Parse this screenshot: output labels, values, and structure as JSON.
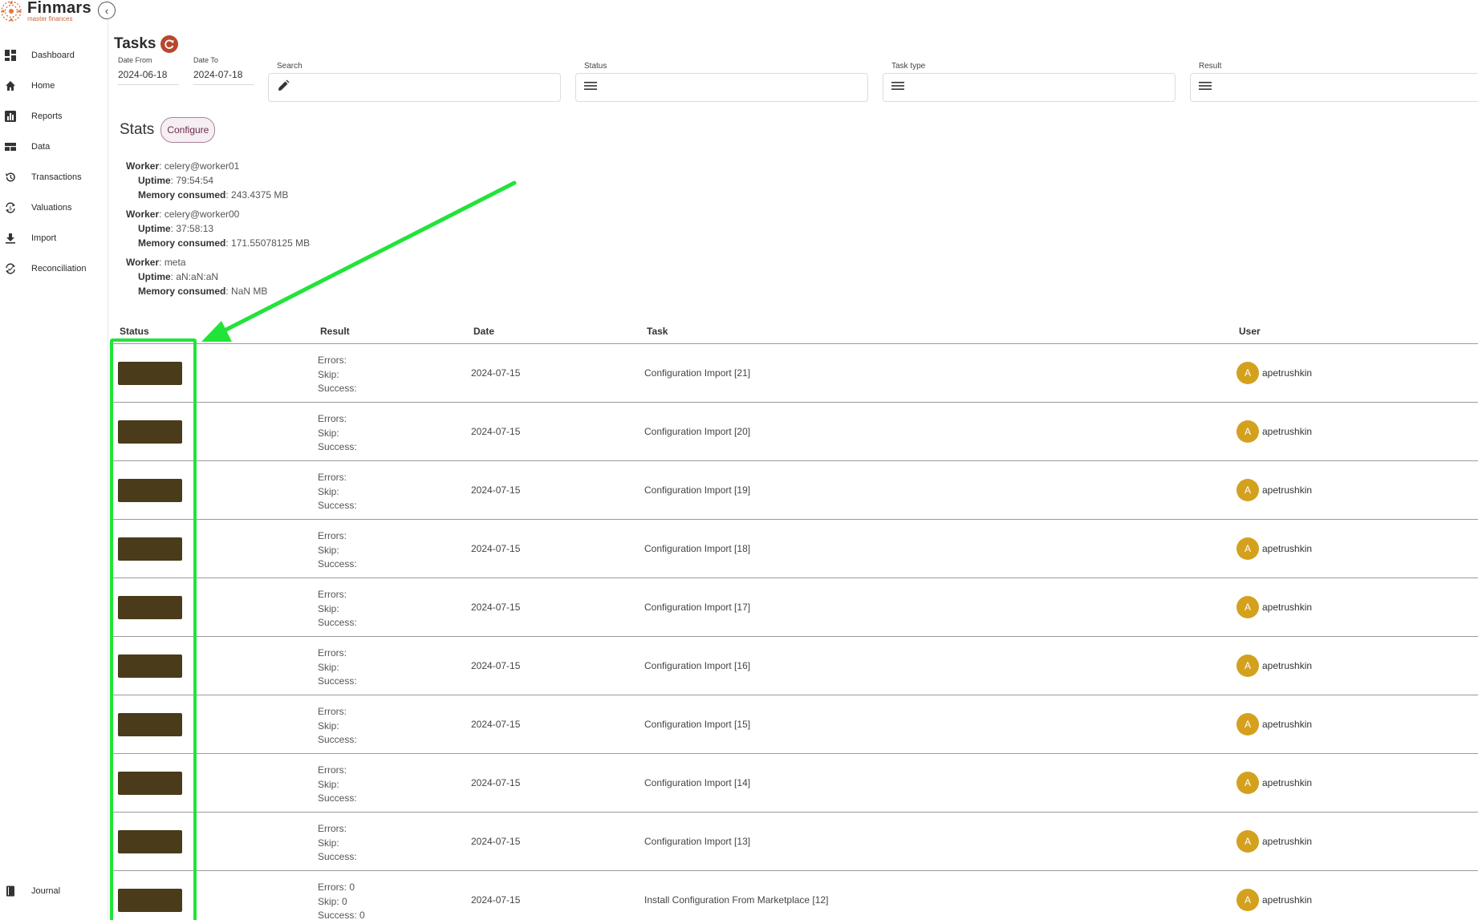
{
  "app": {
    "name": "Finmars",
    "tagline": "master finances"
  },
  "sidebar": {
    "items": [
      {
        "label": "Dashboard",
        "icon": "dashboard-icon"
      },
      {
        "label": "Home",
        "icon": "home-icon"
      },
      {
        "label": "Reports",
        "icon": "reports-icon"
      },
      {
        "label": "Data",
        "icon": "data-icon"
      },
      {
        "label": "Transactions",
        "icon": "history-icon"
      },
      {
        "label": "Valuations",
        "icon": "sync-icon"
      },
      {
        "label": "Import",
        "icon": "download-icon"
      },
      {
        "label": "Reconciliation",
        "icon": "reconcile-icon"
      }
    ],
    "bottom_items": [
      {
        "label": "Journal",
        "icon": "book-icon"
      }
    ]
  },
  "header": {
    "title": "Tasks"
  },
  "filters": {
    "date_from_label": "Date From",
    "date_from": "2024-06-18",
    "date_to_label": "Date To",
    "date_to": "2024-07-18",
    "search_label": "Search",
    "status_label": "Status",
    "task_type_label": "Task type",
    "result_label": "Result"
  },
  "stats": {
    "title": "Stats",
    "configure_label": "Configure",
    "worker_label": "Worker",
    "uptime_label": "Uptime",
    "memory_label": "Memory consumed",
    "workers": [
      {
        "name": "celery@worker01",
        "uptime": "79:54:54",
        "memory": "243.4375 MB"
      },
      {
        "name": "celery@worker00",
        "uptime": "37:58:13",
        "memory": "171.55078125 MB"
      },
      {
        "name": "meta",
        "uptime": "aN:aN:aN",
        "memory": "NaN MB"
      }
    ]
  },
  "table": {
    "columns": {
      "status": "Status",
      "result": "Result",
      "date": "Date",
      "task": "Task",
      "user": "User"
    },
    "rows": [
      {
        "errors": "Errors:",
        "skip": "Skip:",
        "success": "Success:",
        "date": "2024-07-15",
        "task": "Configuration Import [21]",
        "avatar": "A",
        "user": "apetrushkin"
      },
      {
        "errors": "Errors:",
        "skip": "Skip:",
        "success": "Success:",
        "date": "2024-07-15",
        "task": "Configuration Import [20]",
        "avatar": "A",
        "user": "apetrushkin"
      },
      {
        "errors": "Errors:",
        "skip": "Skip:",
        "success": "Success:",
        "date": "2024-07-15",
        "task": "Configuration Import [19]",
        "avatar": "A",
        "user": "apetrushkin"
      },
      {
        "errors": "Errors:",
        "skip": "Skip:",
        "success": "Success:",
        "date": "2024-07-15",
        "task": "Configuration Import [18]",
        "avatar": "A",
        "user": "apetrushkin"
      },
      {
        "errors": "Errors:",
        "skip": "Skip:",
        "success": "Success:",
        "date": "2024-07-15",
        "task": "Configuration Import [17]",
        "avatar": "A",
        "user": "apetrushkin"
      },
      {
        "errors": "Errors:",
        "skip": "Skip:",
        "success": "Success:",
        "date": "2024-07-15",
        "task": "Configuration Import [16]",
        "avatar": "A",
        "user": "apetrushkin"
      },
      {
        "errors": "Errors:",
        "skip": "Skip:",
        "success": "Success:",
        "date": "2024-07-15",
        "task": "Configuration Import [15]",
        "avatar": "A",
        "user": "apetrushkin"
      },
      {
        "errors": "Errors:",
        "skip": "Skip:",
        "success": "Success:",
        "date": "2024-07-15",
        "task": "Configuration Import [14]",
        "avatar": "A",
        "user": "apetrushkin"
      },
      {
        "errors": "Errors:",
        "skip": "Skip:",
        "success": "Success:",
        "date": "2024-07-15",
        "task": "Configuration Import [13]",
        "avatar": "A",
        "user": "apetrushkin"
      },
      {
        "errors": "Errors: 0",
        "skip": "Skip: 0",
        "success": "Success: 0",
        "date": "2024-07-15",
        "task": "Install Configuration From Marketplace [12]",
        "avatar": "A",
        "user": "apetrushkin"
      }
    ]
  },
  "colors": {
    "accent": "#b9472c",
    "status_badge": "#4a3b1a",
    "avatar": "#d4a11e",
    "annotation": "#22e33a"
  }
}
